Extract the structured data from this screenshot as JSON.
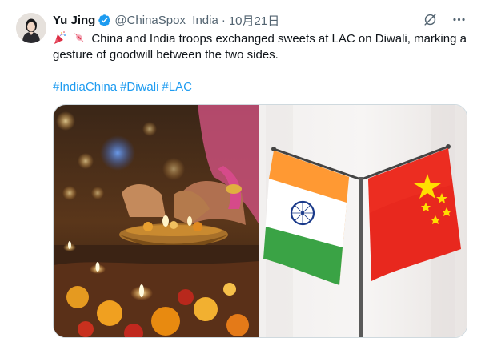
{
  "tweet": {
    "author_name": "Yu Jing",
    "handle": "@ChinaSpox_India",
    "separator": "·",
    "timestamp": "10月21日",
    "text": "China and India troops exchanged sweets at LAC on Diwali, marking a gesture of goodwill between the two sides.",
    "hashtags": [
      "#IndiaChina",
      "#Diwali",
      "#LAC"
    ],
    "verified": true
  },
  "icons": {
    "verified": "verified-badge-icon",
    "grok": "grok-icon",
    "more": "more-icon",
    "emoji1": "party-popper-icon",
    "emoji2": "candy-icon"
  },
  "colors": {
    "link": "#1d9bf0",
    "verified": "#1d9bf0",
    "muted": "#536471"
  },
  "media": {
    "left": "diwali-lamps-photo",
    "right": "india-china-flags-photo"
  }
}
